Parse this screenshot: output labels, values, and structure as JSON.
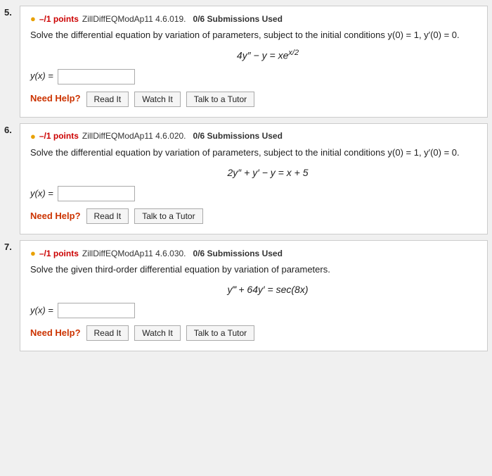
{
  "problems": [
    {
      "number": "5.",
      "icon": "●",
      "points": "–/1 points",
      "meta": "ZillDiffEQModAp11 4.6.019.",
      "submissions": "0/6 Submissions Used",
      "description": "Solve the differential equation by variation of parameters, subject to the initial conditions y(0) = 1, y′(0) = 0.",
      "equation_parts": [
        "4y″ − y = xe",
        "x/2"
      ],
      "equation_text": "4y″ − y = xe",
      "equation_exp": "x/2",
      "answer_label": "y(x) =",
      "buttons": [
        "Read It",
        "Watch It",
        "Talk to a Tutor"
      ],
      "need_help": "Need Help?"
    },
    {
      "number": "6.",
      "icon": "●",
      "points": "–/1 points",
      "meta": "ZillDiffEQModAp11 4.6.020.",
      "submissions": "0/6 Submissions Used",
      "description": "Solve the differential equation by variation of parameters, subject to the initial conditions y(0) = 1, y′(0) = 0.",
      "equation_text": "2y″ + y′ − y = x + 5",
      "equation_exp": "",
      "answer_label": "y(x) =",
      "buttons": [
        "Read It",
        "Talk to a Tutor"
      ],
      "need_help": "Need Help?"
    },
    {
      "number": "7.",
      "icon": "●",
      "points": "–/1 points",
      "meta": "ZillDiffEQModAp11 4.6.030.",
      "submissions": "0/6 Submissions Used",
      "description": "Solve the given third-order differential equation by variation of parameters.",
      "equation_text": "y‴ + 64y′ = sec(8x)",
      "equation_exp": "",
      "answer_label": "y(x) =",
      "buttons": [
        "Read It",
        "Watch It",
        "Talk to a Tutor"
      ],
      "need_help": "Need Help?"
    }
  ]
}
